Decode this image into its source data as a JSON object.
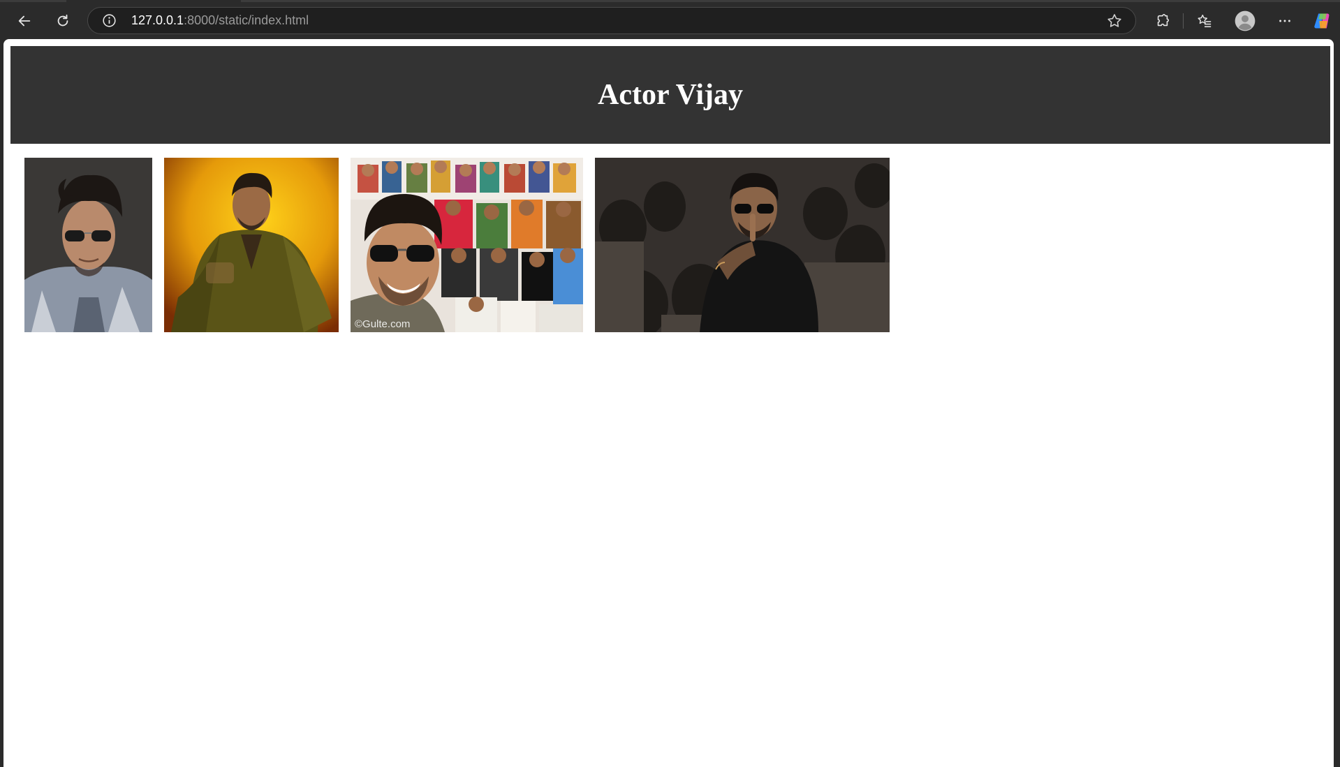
{
  "browser": {
    "url_host": "127.0.0.1",
    "url_path": ":8000/static/index.html"
  },
  "page": {
    "title": "Actor Vijay",
    "images": [
      {
        "alt": "Vijay portrait in checked shirt and aviator sunglasses"
      },
      {
        "alt": "Vijay seated in olive shirt on yellow background"
      },
      {
        "alt": "Vijay selfie with crowd of characters"
      },
      {
        "alt": "Vijay in black with finger on lips among crowd"
      }
    ],
    "watermark": "©Gulte.com"
  },
  "colors": {
    "header_bg": "#333333",
    "chrome_bg": "#2b2b2b"
  }
}
